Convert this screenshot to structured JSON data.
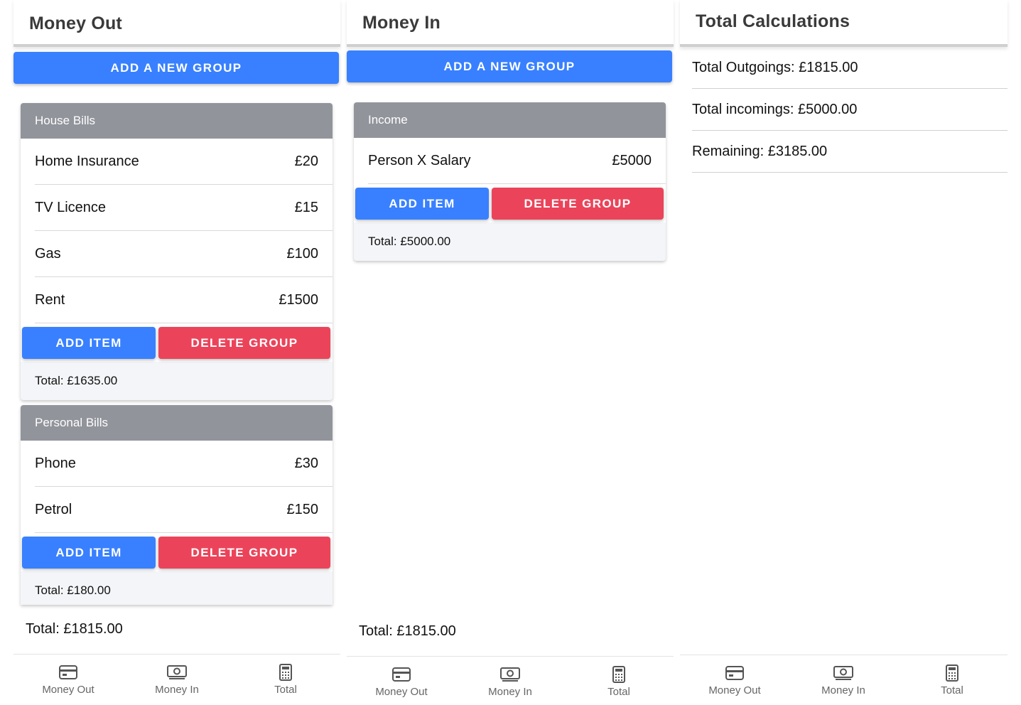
{
  "money_out": {
    "title": "Money Out",
    "add_group_label": "ADD A NEW GROUP",
    "groups": [
      {
        "name": "House Bills",
        "items": [
          {
            "label": "Home Insurance",
            "amount": "£20"
          },
          {
            "label": "TV Licence",
            "amount": "£15"
          },
          {
            "label": "Gas",
            "amount": "£100"
          },
          {
            "label": "Rent",
            "amount": "£1500"
          }
        ],
        "add_item_label": "ADD ITEM",
        "delete_group_label": "DELETE GROUP",
        "total": "Total: £1635.00"
      },
      {
        "name": "Personal Bills",
        "items": [
          {
            "label": "Phone",
            "amount": "£30"
          },
          {
            "label": "Petrol",
            "amount": "£150"
          }
        ],
        "add_item_label": "ADD ITEM",
        "delete_group_label": "DELETE GROUP",
        "total": "Total: £180.00"
      }
    ],
    "screen_total": "Total: £1815.00"
  },
  "money_in": {
    "title": "Money In",
    "add_group_label": "ADD A NEW GROUP",
    "groups": [
      {
        "name": "Income",
        "items": [
          {
            "label": "Person X Salary",
            "amount": "£5000"
          }
        ],
        "add_item_label": "ADD ITEM",
        "delete_group_label": "DELETE GROUP",
        "total": "Total: £5000.00"
      }
    ],
    "screen_total": "Total: £1815.00"
  },
  "totals": {
    "title": "Total Calculations",
    "rows": [
      "Total Outgoings: £1815.00",
      "Total incomings: £5000.00",
      "Remaining: £3185.00"
    ]
  },
  "tabs": [
    {
      "label": "Money Out",
      "icon": "card-icon"
    },
    {
      "label": "Money In",
      "icon": "cash-icon"
    },
    {
      "label": "Total",
      "icon": "calculator-icon"
    }
  ],
  "colors": {
    "primary": "#3880ff",
    "danger": "#eb445a",
    "card_header": "#92949c",
    "card_bg": "#f4f5f8"
  }
}
